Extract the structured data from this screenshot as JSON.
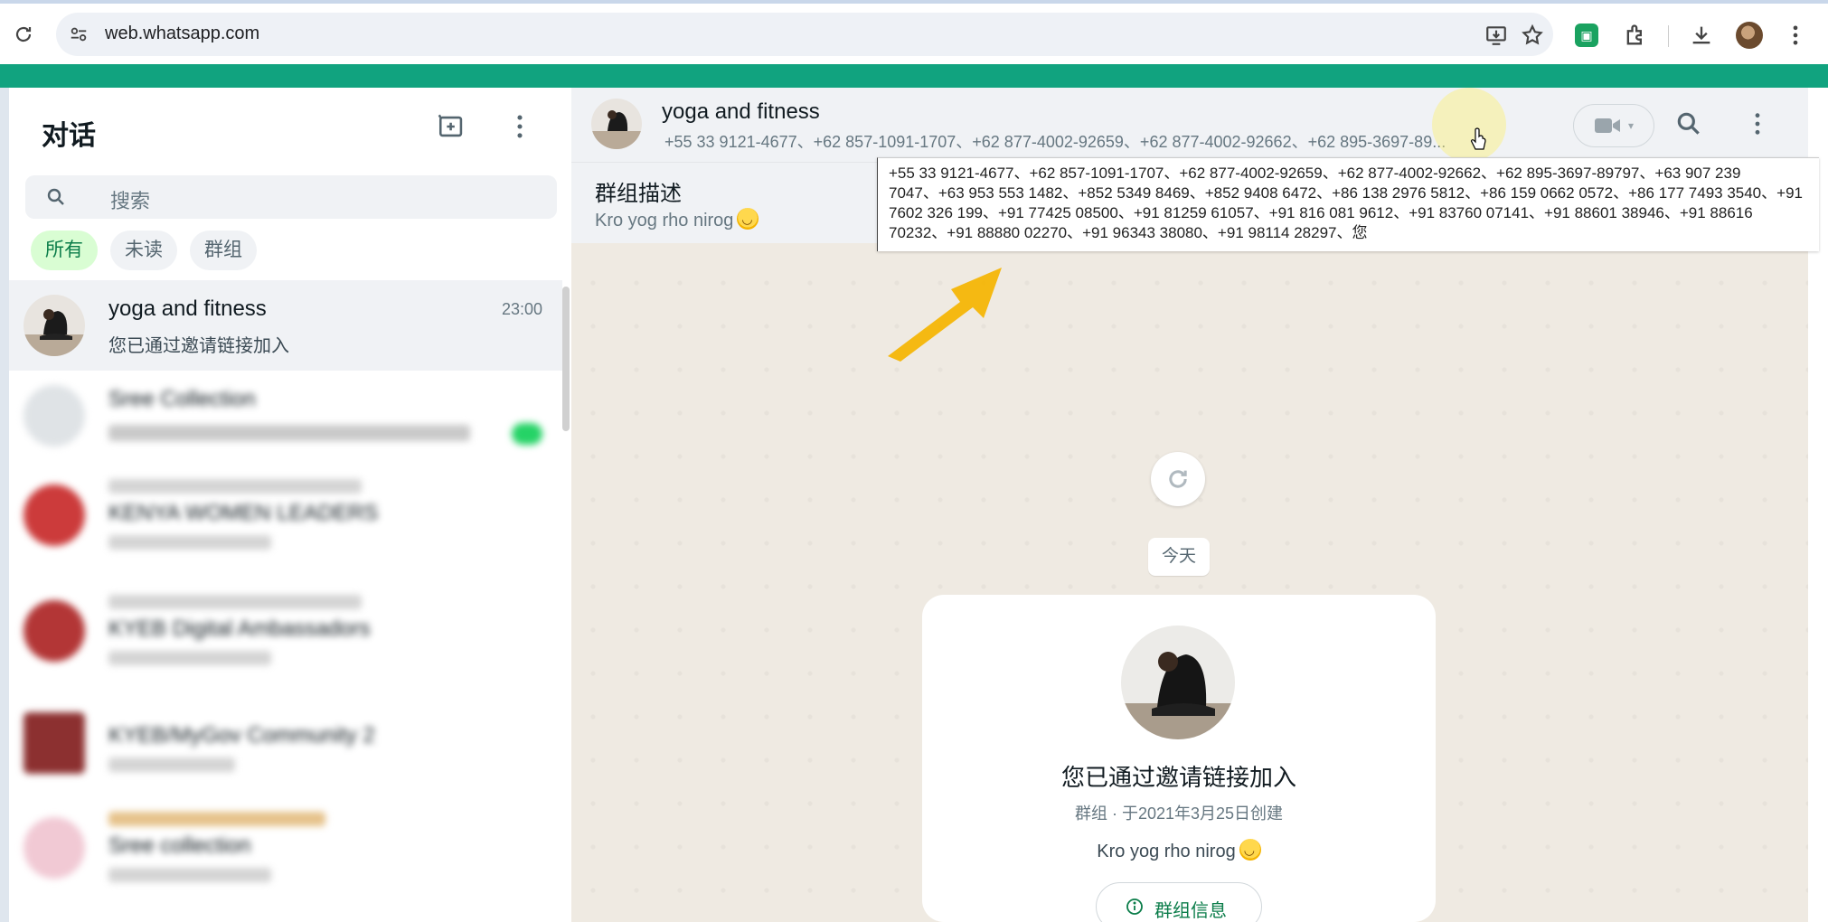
{
  "browser": {
    "url": "web.whatsapp.com"
  },
  "sidebar": {
    "title": "对话",
    "search_placeholder": "搜索",
    "filters": [
      "所有",
      "未读",
      "群组"
    ],
    "chats": [
      {
        "name": "yoga and fitness",
        "preview": "您已通过邀请链接加入",
        "time": "23:00",
        "blurred": false
      },
      {
        "name": "Sree Collection",
        "preview": "",
        "time": "",
        "blurred": true
      },
      {
        "name": "KENYA WOMEN LEADERS",
        "preview": "",
        "time": "",
        "blurred": true
      },
      {
        "name": "KYEB Digital Ambassadors",
        "preview": "",
        "time": "",
        "blurred": true
      },
      {
        "name": "KYEB/MyGov Community 2",
        "preview": "",
        "time": "",
        "blurred": true
      },
      {
        "name": "Sree collection",
        "preview": "",
        "time": "",
        "blurred": true
      }
    ]
  },
  "chat": {
    "title": "yoga and fitness",
    "members_truncated": "+55 33 9121-4677、+62 857-1091-1707、+62 877-4002-92659、+62 877-4002-92662、+62 895-3697-89...",
    "members_full": "+55 33 9121-4677、+62 857-1091-1707、+62 877-4002-92659、+62 877-4002-92662、+62 895-3697-89797、+63 907 239 7047、+63 953 553 1482、+852 5349 8469、+852 9408 6472、+86 138 2976 5812、+86 159 0662 0572、+86 177 7493 3540、+91 7602 326 199、+91 77425 08500、+91 81259 61057、+91 816 081 9612、+91 83760 07141、+91 88601 38946、+91 88616 70232、+91 88880 02270、+91 96343 38080、+91 98114 28297、您",
    "description_title": "群组描述",
    "description_text": "Kro yog rho nirog",
    "date_chip": "今天",
    "card": {
      "title": "您已通过邀请链接加入",
      "subtitle": "群组 · 于2021年3月25日创建",
      "description": "Kro yog rho nirog",
      "button_label": "群组信息"
    }
  },
  "colors": {
    "accent": "#11a37f",
    "arrow": "#f5b400"
  }
}
